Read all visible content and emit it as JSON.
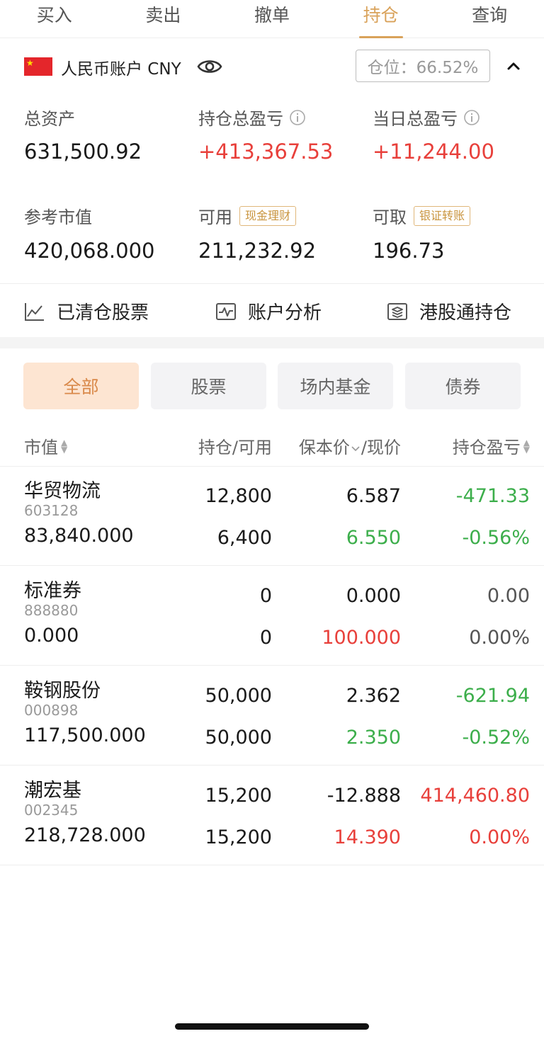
{
  "tabs": [
    {
      "label": "买入"
    },
    {
      "label": "卖出"
    },
    {
      "label": "撤单"
    },
    {
      "label": "持仓",
      "active": true
    },
    {
      "label": "查询"
    }
  ],
  "account": {
    "name": "人民币账户 CNY",
    "position_ratio": "仓位：66.52%",
    "flag_icon": "china-flag-icon",
    "eye_icon": "eye-icon",
    "collapse_icon": "chevron-up-icon"
  },
  "stats": {
    "total_assets": {
      "label": "总资产",
      "value": "631,500.92"
    },
    "holding_pl": {
      "label": "持仓总盈亏",
      "value": "+413,367.53"
    },
    "daily_pl": {
      "label": "当日总盈亏",
      "value": "+11,244.00"
    },
    "market_value": {
      "label": "参考市值",
      "value": "420,068.000"
    },
    "available": {
      "label": "可用",
      "value": "211,232.92",
      "tag": "现金理财"
    },
    "withdrawable": {
      "label": "可取",
      "value": "196.73",
      "tag": "银证转账"
    }
  },
  "links": [
    {
      "label": "已清仓股票",
      "icon": "line-chart-icon"
    },
    {
      "label": "账户分析",
      "icon": "pulse-monitor-icon"
    },
    {
      "label": "港股通持仓",
      "icon": "layers-icon"
    }
  ],
  "filters": [
    {
      "label": "全部",
      "active": true
    },
    {
      "label": "股票"
    },
    {
      "label": "场内基金"
    },
    {
      "label": "债券"
    }
  ],
  "table": {
    "headers": {
      "market_value": "市值",
      "hold_available": "持仓/可用",
      "cost_price": "保本价",
      "current_price": "/现价",
      "holding_pl": "持仓盈亏"
    },
    "rows": [
      {
        "name": "华贸物流",
        "code": "603128",
        "market_value": "83,840.000",
        "hold": "12,800",
        "available": "6,400",
        "cost": "6.587",
        "price": "6.550",
        "price_color": "green",
        "pl": "-471.33",
        "pl_pct": "-0.56%",
        "pl_color": "green"
      },
      {
        "name": "标准券",
        "code": "888880",
        "market_value": "0.000",
        "hold": "0",
        "available": "0",
        "cost": "0.000",
        "price": "100.000",
        "price_color": "red",
        "pl": "0.00",
        "pl_pct": "0.00%",
        "pl_color": "muted"
      },
      {
        "name": "鞍钢股份",
        "code": "000898",
        "market_value": "117,500.000",
        "hold": "50,000",
        "available": "50,000",
        "cost": "2.362",
        "price": "2.350",
        "price_color": "green",
        "pl": "-621.94",
        "pl_pct": "-0.52%",
        "pl_color": "green"
      },
      {
        "name": "潮宏基",
        "code": "002345",
        "market_value": "218,728.000",
        "hold": "15,200",
        "available": "15,200",
        "cost": "-12.888",
        "price": "14.390",
        "price_color": "red",
        "pl": "414,460.80",
        "pl_pct": "0.00%",
        "pl_color": "red"
      }
    ]
  },
  "colors": {
    "accent": "#d9a25a",
    "up": "#e8403b",
    "down": "#3cae4b"
  }
}
